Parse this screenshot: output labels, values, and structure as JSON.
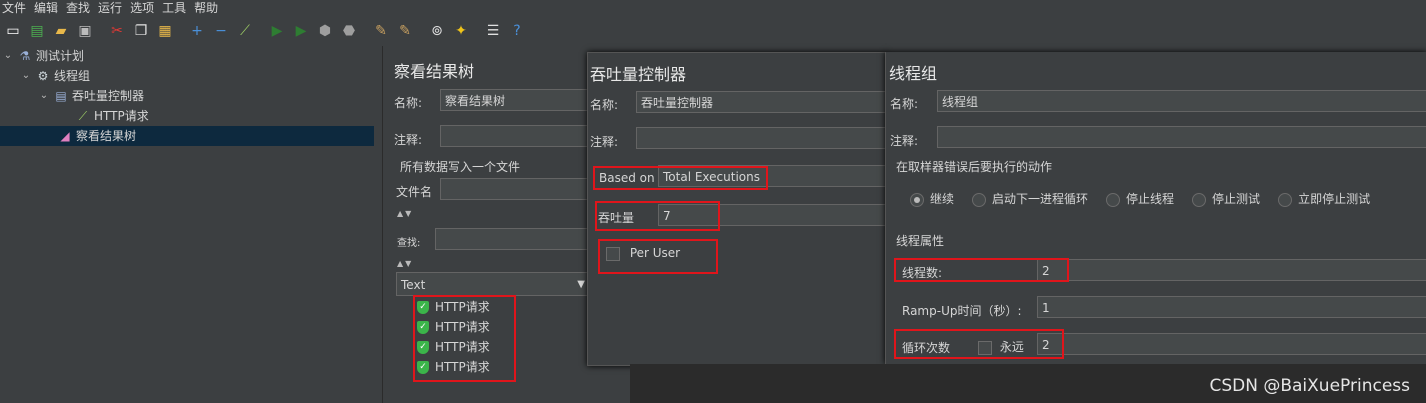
{
  "menu": [
    "文件",
    "编辑",
    "查找",
    "运行",
    "选项",
    "工具",
    "帮助"
  ],
  "toolbar_icons": [
    "new-icon",
    "templates-icon",
    "open-icon",
    "save-icon",
    "cut-icon",
    "copy-icon",
    "paste-icon",
    "expand-icon",
    "collapse-icon",
    "toggle-icon",
    "start-icon",
    "start-no-pause-icon",
    "stop-icon",
    "shutdown-icon",
    "clear-icon",
    "clear-all-icon",
    "search-icon",
    "reset-search-icon",
    "function-helper-icon",
    "help-icon"
  ],
  "tree": {
    "plan": "测试计划",
    "group": "线程组",
    "controller": "吞吐量控制器",
    "sampler": "HTTP请求",
    "listener": "察看结果树"
  },
  "results_panel": {
    "title": "察看结果树",
    "name_label": "名称:",
    "name_value": "察看结果树",
    "comment_label": "注释:",
    "file_section": "所有数据写入一个文件",
    "filename_label": "文件名",
    "search_label": "查找:",
    "renderer": "Text",
    "results": [
      "HTTP请求",
      "HTTP请求",
      "HTTP请求",
      "HTTP请求"
    ]
  },
  "throughput_panel": {
    "title": "吞吐量控制器",
    "name_label": "名称:",
    "name_value": "吞吐量控制器",
    "comment_label": "注释:",
    "based_on_label": "Based on",
    "based_on_value": "Total Executions",
    "throughput_label": "吞吐量",
    "throughput_value": "7",
    "per_user_label": "Per User"
  },
  "thread_panel": {
    "title": "线程组",
    "name_label": "名称:",
    "name_value": "线程组",
    "comment_label": "注释:",
    "error_section": "在取样器错误后要执行的动作",
    "actions": [
      "继续",
      "启动下一进程循环",
      "停止线程",
      "停止测试",
      "立即停止测试"
    ],
    "props_section": "线程属性",
    "threads_label": "线程数:",
    "threads_value": "2",
    "rampup_label": "Ramp-Up时间（秒）:",
    "rampup_value": "1",
    "loop_label": "循环次数",
    "forever_label": "永远",
    "loop_value": "2"
  },
  "watermark": "CSDN @BaiXuePrincess"
}
